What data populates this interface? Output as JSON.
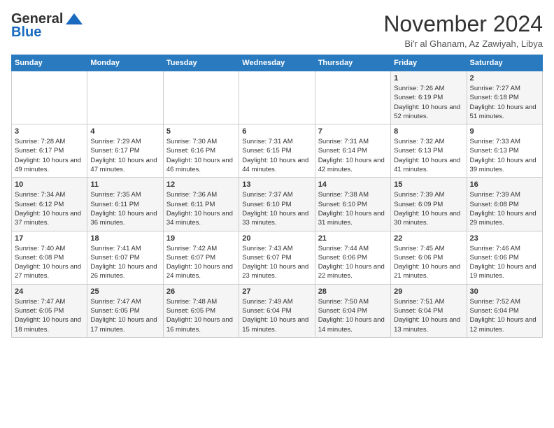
{
  "header": {
    "logo_line1": "General",
    "logo_line2": "Blue",
    "month_title": "November 2024",
    "location": "Bi'r al Ghanam, Az Zawiyah, Libya"
  },
  "days_of_week": [
    "Sunday",
    "Monday",
    "Tuesday",
    "Wednesday",
    "Thursday",
    "Friday",
    "Saturday"
  ],
  "weeks": [
    [
      {
        "day": "",
        "info": ""
      },
      {
        "day": "",
        "info": ""
      },
      {
        "day": "",
        "info": ""
      },
      {
        "day": "",
        "info": ""
      },
      {
        "day": "",
        "info": ""
      },
      {
        "day": "1",
        "info": "Sunrise: 7:26 AM\nSunset: 6:19 PM\nDaylight: 10 hours and 52 minutes."
      },
      {
        "day": "2",
        "info": "Sunrise: 7:27 AM\nSunset: 6:18 PM\nDaylight: 10 hours and 51 minutes."
      }
    ],
    [
      {
        "day": "3",
        "info": "Sunrise: 7:28 AM\nSunset: 6:17 PM\nDaylight: 10 hours and 49 minutes."
      },
      {
        "day": "4",
        "info": "Sunrise: 7:29 AM\nSunset: 6:17 PM\nDaylight: 10 hours and 47 minutes."
      },
      {
        "day": "5",
        "info": "Sunrise: 7:30 AM\nSunset: 6:16 PM\nDaylight: 10 hours and 46 minutes."
      },
      {
        "day": "6",
        "info": "Sunrise: 7:31 AM\nSunset: 6:15 PM\nDaylight: 10 hours and 44 minutes."
      },
      {
        "day": "7",
        "info": "Sunrise: 7:31 AM\nSunset: 6:14 PM\nDaylight: 10 hours and 42 minutes."
      },
      {
        "day": "8",
        "info": "Sunrise: 7:32 AM\nSunset: 6:13 PM\nDaylight: 10 hours and 41 minutes."
      },
      {
        "day": "9",
        "info": "Sunrise: 7:33 AM\nSunset: 6:13 PM\nDaylight: 10 hours and 39 minutes."
      }
    ],
    [
      {
        "day": "10",
        "info": "Sunrise: 7:34 AM\nSunset: 6:12 PM\nDaylight: 10 hours and 37 minutes."
      },
      {
        "day": "11",
        "info": "Sunrise: 7:35 AM\nSunset: 6:11 PM\nDaylight: 10 hours and 36 minutes."
      },
      {
        "day": "12",
        "info": "Sunrise: 7:36 AM\nSunset: 6:11 PM\nDaylight: 10 hours and 34 minutes."
      },
      {
        "day": "13",
        "info": "Sunrise: 7:37 AM\nSunset: 6:10 PM\nDaylight: 10 hours and 33 minutes."
      },
      {
        "day": "14",
        "info": "Sunrise: 7:38 AM\nSunset: 6:10 PM\nDaylight: 10 hours and 31 minutes."
      },
      {
        "day": "15",
        "info": "Sunrise: 7:39 AM\nSunset: 6:09 PM\nDaylight: 10 hours and 30 minutes."
      },
      {
        "day": "16",
        "info": "Sunrise: 7:39 AM\nSunset: 6:08 PM\nDaylight: 10 hours and 29 minutes."
      }
    ],
    [
      {
        "day": "17",
        "info": "Sunrise: 7:40 AM\nSunset: 6:08 PM\nDaylight: 10 hours and 27 minutes."
      },
      {
        "day": "18",
        "info": "Sunrise: 7:41 AM\nSunset: 6:07 PM\nDaylight: 10 hours and 26 minutes."
      },
      {
        "day": "19",
        "info": "Sunrise: 7:42 AM\nSunset: 6:07 PM\nDaylight: 10 hours and 24 minutes."
      },
      {
        "day": "20",
        "info": "Sunrise: 7:43 AM\nSunset: 6:07 PM\nDaylight: 10 hours and 23 minutes."
      },
      {
        "day": "21",
        "info": "Sunrise: 7:44 AM\nSunset: 6:06 PM\nDaylight: 10 hours and 22 minutes."
      },
      {
        "day": "22",
        "info": "Sunrise: 7:45 AM\nSunset: 6:06 PM\nDaylight: 10 hours and 21 minutes."
      },
      {
        "day": "23",
        "info": "Sunrise: 7:46 AM\nSunset: 6:06 PM\nDaylight: 10 hours and 19 minutes."
      }
    ],
    [
      {
        "day": "24",
        "info": "Sunrise: 7:47 AM\nSunset: 6:05 PM\nDaylight: 10 hours and 18 minutes."
      },
      {
        "day": "25",
        "info": "Sunrise: 7:47 AM\nSunset: 6:05 PM\nDaylight: 10 hours and 17 minutes."
      },
      {
        "day": "26",
        "info": "Sunrise: 7:48 AM\nSunset: 6:05 PM\nDaylight: 10 hours and 16 minutes."
      },
      {
        "day": "27",
        "info": "Sunrise: 7:49 AM\nSunset: 6:04 PM\nDaylight: 10 hours and 15 minutes."
      },
      {
        "day": "28",
        "info": "Sunrise: 7:50 AM\nSunset: 6:04 PM\nDaylight: 10 hours and 14 minutes."
      },
      {
        "day": "29",
        "info": "Sunrise: 7:51 AM\nSunset: 6:04 PM\nDaylight: 10 hours and 13 minutes."
      },
      {
        "day": "30",
        "info": "Sunrise: 7:52 AM\nSunset: 6:04 PM\nDaylight: 10 hours and 12 minutes."
      }
    ]
  ]
}
